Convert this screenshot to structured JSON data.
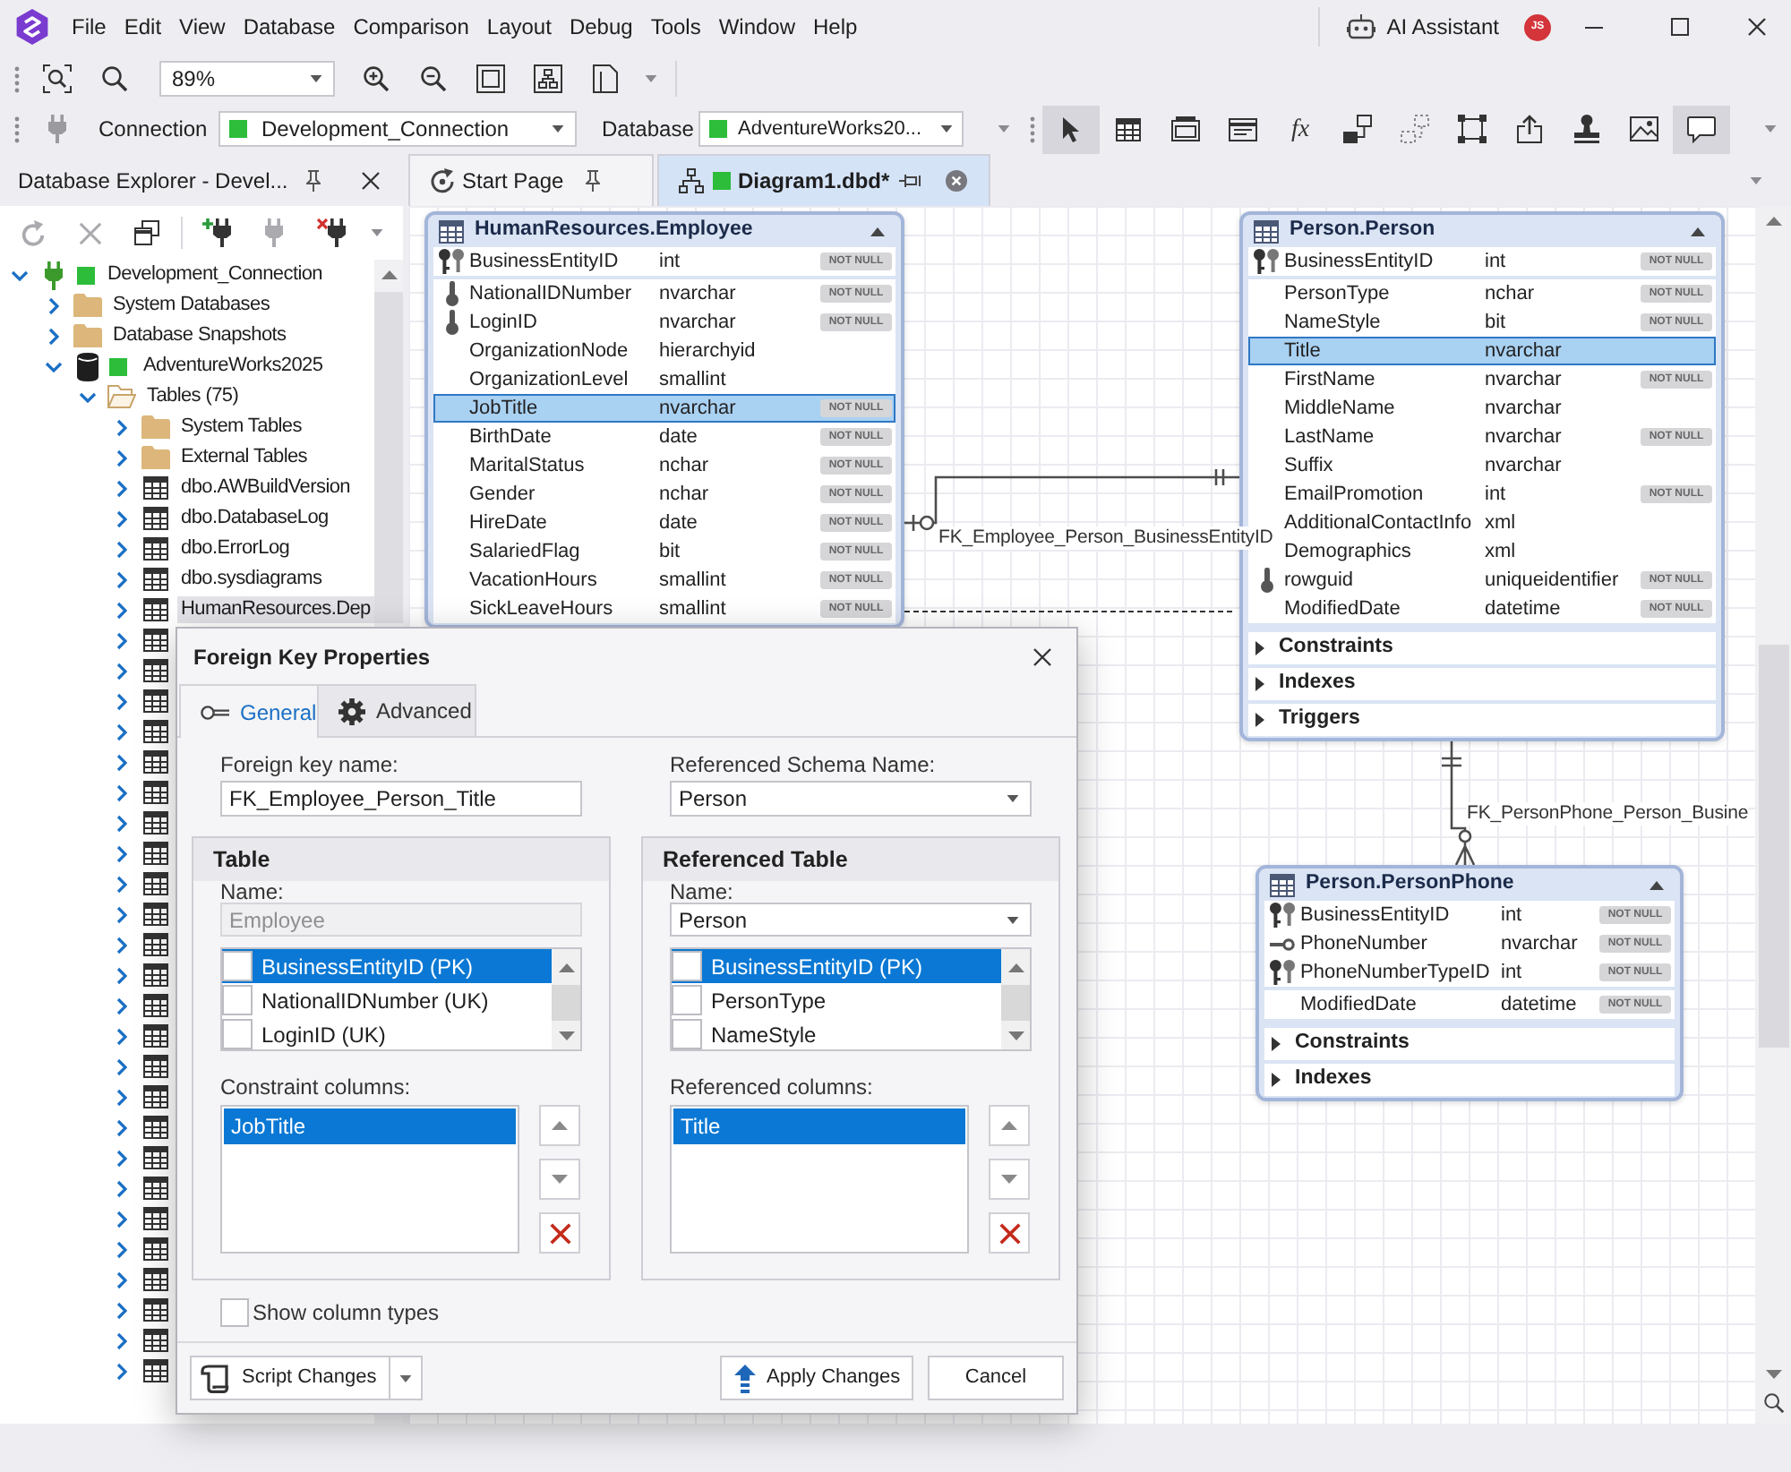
{
  "title_bar": {
    "menu": [
      "File",
      "Edit",
      "View",
      "Database",
      "Comparison",
      "Layout",
      "Debug",
      "Tools",
      "Window",
      "Help"
    ],
    "assistant": "AI Assistant",
    "avatar": "JS"
  },
  "toolbar": {
    "zoom": "89%"
  },
  "connection_bar": {
    "connection_label": "Connection",
    "connection": "Development_Connection",
    "database_label": "Database",
    "database": "AdventureWorks20...",
    "tools": [
      {
        "kind": "pointer",
        "selected": true
      },
      {
        "kind": "table",
        "selected": false
      },
      {
        "kind": "view",
        "selected": false
      },
      {
        "kind": "procedure",
        "selected": false
      },
      {
        "kind": "function",
        "glyph": "fx",
        "selected": false
      },
      {
        "kind": "relation",
        "selected": false
      },
      {
        "kind": "virtual_relation",
        "selected": false
      },
      {
        "kind": "container",
        "selected": false
      },
      {
        "kind": "export",
        "selected": false
      },
      {
        "kind": "stamp",
        "selected": false
      },
      {
        "kind": "image",
        "selected": false
      },
      {
        "kind": "note",
        "selected": true
      }
    ]
  },
  "explorer": {
    "title": "Database Explorer - Devel...",
    "tools": [
      {
        "kind": "refresh",
        "disabled": true
      },
      {
        "kind": "delete",
        "disabled": true
      },
      {
        "kind": "windows",
        "disabled": false
      },
      {
        "kind": "new_connection",
        "disabled": false
      },
      {
        "kind": "disconnect",
        "disabled": true
      },
      {
        "kind": "remove_connection",
        "disabled": false
      }
    ],
    "tree": [
      {
        "label": "Development_Connection",
        "kind": "connection",
        "expanded": true,
        "selected": false,
        "children": [
          {
            "label": "System Databases",
            "kind": "folder",
            "expanded": false,
            "selected": false
          },
          {
            "label": "Database Snapshots",
            "kind": "folder",
            "expanded": false,
            "selected": false
          },
          {
            "label": "AdventureWorks2025",
            "kind": "database",
            "expanded": true,
            "selected": false,
            "children": [
              {
                "label": "Tables (75)",
                "kind": "folder",
                "expanded": true,
                "selected": false,
                "children": [
                  {
                    "label": "System Tables",
                    "kind": "folder",
                    "expanded": false,
                    "selected": false
                  },
                  {
                    "label": "External Tables",
                    "kind": "folder",
                    "expanded": false,
                    "selected": false
                  },
                  {
                    "label": "dbo.AWBuildVersion",
                    "kind": "table",
                    "expanded": false,
                    "selected": false
                  },
                  {
                    "label": "dbo.DatabaseLog",
                    "kind": "table",
                    "expanded": false,
                    "selected": false
                  },
                  {
                    "label": "dbo.ErrorLog",
                    "kind": "table",
                    "expanded": false,
                    "selected": false
                  },
                  {
                    "label": "dbo.sysdiagrams",
                    "kind": "table",
                    "expanded": false,
                    "selected": false
                  },
                  {
                    "label": "HumanResources.Dep",
                    "kind": "table",
                    "expanded": false,
                    "selected": true
                  },
                  {
                    "kind": "table",
                    "expanded": false,
                    "selected": false
                  },
                  {
                    "kind": "table",
                    "expanded": false,
                    "selected": false
                  },
                  {
                    "kind": "table",
                    "expanded": false,
                    "selected": false
                  },
                  {
                    "kind": "table",
                    "expanded": false,
                    "selected": false
                  },
                  {
                    "kind": "table",
                    "expanded": false,
                    "selected": false
                  },
                  {
                    "kind": "table",
                    "expanded": false,
                    "selected": false
                  },
                  {
                    "kind": "table",
                    "expanded": false,
                    "selected": false
                  },
                  {
                    "kind": "table",
                    "expanded": false,
                    "selected": false
                  },
                  {
                    "kind": "table",
                    "expanded": false,
                    "selected": false
                  },
                  {
                    "kind": "table",
                    "expanded": false,
                    "selected": false
                  },
                  {
                    "kind": "table",
                    "expanded": false,
                    "selected": false
                  },
                  {
                    "kind": "table",
                    "expanded": false,
                    "selected": false
                  },
                  {
                    "kind": "table",
                    "expanded": false,
                    "selected": false
                  },
                  {
                    "kind": "table",
                    "expanded": false,
                    "selected": false
                  },
                  {
                    "kind": "table",
                    "expanded": false,
                    "selected": false
                  },
                  {
                    "kind": "table",
                    "expanded": false,
                    "selected": false
                  },
                  {
                    "kind": "table",
                    "expanded": false,
                    "selected": false
                  },
                  {
                    "kind": "table",
                    "expanded": false,
                    "selected": false
                  },
                  {
                    "kind": "table",
                    "expanded": false,
                    "selected": false
                  },
                  {
                    "kind": "table",
                    "expanded": false,
                    "selected": false
                  },
                  {
                    "kind": "table",
                    "expanded": false,
                    "selected": false
                  },
                  {
                    "kind": "table",
                    "expanded": false,
                    "selected": false
                  },
                  {
                    "kind": "table",
                    "expanded": false,
                    "selected": false
                  },
                  {
                    "kind": "table",
                    "expanded": false,
                    "selected": false
                  },
                  {
                    "kind": "table",
                    "expanded": false,
                    "selected": false
                  }
                ]
              }
            ]
          }
        ]
      }
    ]
  },
  "document_tabs": [
    {
      "label": "Start Page",
      "kind": "start",
      "selected": false
    },
    {
      "label": "Diagram1.dbd*",
      "kind": "diagram",
      "selected": true
    }
  ],
  "diagram": {
    "tables": [
      {
        "name": "HumanResources.Employee",
        "key_columns": [
          {
            "name": "BusinessEntityID",
            "type": "int",
            "kind": "foreign",
            "flag": "NOT NULL",
            "selected": false
          }
        ],
        "columns": [
          {
            "name": "NationalIDNumber",
            "type": "nvarchar",
            "kind": "unique",
            "flag": "NOT NULL",
            "selected": false
          },
          {
            "name": "LoginID",
            "type": "nvarchar",
            "kind": "unique",
            "flag": "NOT NULL",
            "selected": false
          },
          {
            "name": "OrganizationNode",
            "type": "hierarchyid",
            "kind": "plain",
            "selected": false
          },
          {
            "name": "OrganizationLevel",
            "type": "smallint",
            "kind": "plain",
            "selected": false
          },
          {
            "name": "JobTitle",
            "type": "nvarchar",
            "kind": "plain",
            "flag": "NOT NULL",
            "selected": true
          },
          {
            "name": "BirthDate",
            "type": "date",
            "kind": "plain",
            "flag": "NOT NULL",
            "selected": false
          },
          {
            "name": "MaritalStatus",
            "type": "nchar",
            "kind": "plain",
            "flag": "NOT NULL",
            "selected": false
          },
          {
            "name": "Gender",
            "type": "nchar",
            "kind": "plain",
            "flag": "NOT NULL",
            "selected": false
          },
          {
            "name": "HireDate",
            "type": "date",
            "kind": "plain",
            "flag": "NOT NULL",
            "selected": false
          },
          {
            "name": "SalariedFlag",
            "type": "bit",
            "kind": "plain",
            "flag": "NOT NULL",
            "selected": false
          },
          {
            "name": "VacationHours",
            "type": "smallint",
            "kind": "plain",
            "flag": "NOT NULL",
            "selected": false
          },
          {
            "name": "SickLeaveHours",
            "type": "smallint",
            "kind": "plain",
            "flag": "NOT NULL",
            "selected": false
          }
        ]
      },
      {
        "name": "Person.Person",
        "key_columns": [
          {
            "name": "BusinessEntityID",
            "type": "int",
            "kind": "foreign",
            "flag": "NOT NULL",
            "selected": false
          }
        ],
        "columns": [
          {
            "name": "PersonType",
            "type": "nchar",
            "kind": "plain",
            "flag": "NOT NULL",
            "selected": false
          },
          {
            "name": "NameStyle",
            "type": "bit",
            "kind": "plain",
            "flag": "NOT NULL",
            "selected": false
          },
          {
            "name": "Title",
            "type": "nvarchar",
            "kind": "plain",
            "selected": true
          },
          {
            "name": "FirstName",
            "type": "nvarchar",
            "kind": "plain",
            "flag": "NOT NULL",
            "selected": false
          },
          {
            "name": "MiddleName",
            "type": "nvarchar",
            "kind": "plain",
            "selected": false
          },
          {
            "name": "LastName",
            "type": "nvarchar",
            "kind": "plain",
            "flag": "NOT NULL",
            "selected": false
          },
          {
            "name": "Suffix",
            "type": "nvarchar",
            "kind": "plain",
            "selected": false
          },
          {
            "name": "EmailPromotion",
            "type": "int",
            "kind": "plain",
            "flag": "NOT NULL",
            "selected": false
          },
          {
            "name": "AdditionalContactInfo",
            "type": "xml",
            "kind": "plain",
            "selected": false
          },
          {
            "name": "Demographics",
            "type": "xml",
            "kind": "plain",
            "selected": false
          },
          {
            "name": "rowguid",
            "type": "uniqueidentifier",
            "kind": "unique",
            "flag": "NOT NULL",
            "selected": false
          },
          {
            "name": "ModifiedDate",
            "type": "datetime",
            "kind": "plain",
            "flag": "NOT NULL",
            "selected": false
          }
        ],
        "sections": [
          {
            "label": "Constraints",
            "expanded": false
          },
          {
            "label": "Indexes",
            "expanded": false
          },
          {
            "label": "Triggers",
            "expanded": false
          }
        ]
      },
      {
        "name": "Person.PersonPhone",
        "key_columns": [
          {
            "name": "BusinessEntityID",
            "type": "int",
            "kind": "foreign",
            "flag": "NOT NULL",
            "selected": false
          },
          {
            "name": "PhoneNumber",
            "type": "nvarchar",
            "kind": "primary",
            "flag": "NOT NULL",
            "selected": false
          },
          {
            "name": "PhoneNumberTypeID",
            "type": "int",
            "kind": "foreign",
            "flag": "NOT NULL",
            "selected": false
          }
        ],
        "columns": [
          {
            "name": "ModifiedDate",
            "type": "datetime",
            "kind": "plain",
            "flag": "NOT NULL",
            "selected": false
          }
        ],
        "sections": [
          {
            "label": "Constraints",
            "expanded": false
          },
          {
            "label": "Indexes",
            "expanded": false
          }
        ]
      }
    ],
    "relations": [
      {
        "name": "FK_Employee_Person_BusinessEntityID"
      },
      {
        "name": "FK_PersonPhone_Person_Busine"
      }
    ]
  },
  "dialog": {
    "title": "Foreign Key Properties",
    "tabs": [
      {
        "label": "General",
        "kind": "general",
        "selected": true
      },
      {
        "label": "Advanced",
        "kind": "advanced",
        "selected": false
      }
    ],
    "fields": [
      {
        "label": "Foreign key name:",
        "value": "FK_Employee_Person_Title",
        "kind": "text"
      },
      {
        "label": "Referenced Schema Name:",
        "value": "Person",
        "kind": "combo"
      }
    ],
    "groups": [
      {
        "title": "Table",
        "name_label": "Name:",
        "name": {
          "value": "Employee",
          "disabled": true
        },
        "columns": [
          {
            "label": "BusinessEntityID (PK)",
            "checked": false,
            "selected": true
          },
          {
            "label": "NationalIDNumber (UK)",
            "checked": false,
            "selected": false
          },
          {
            "label": "LoginID (UK)",
            "checked": false,
            "selected": false
          }
        ],
        "list_label": "Constraint columns:",
        "list": [
          {
            "label": "JobTitle",
            "selected": true
          }
        ]
      },
      {
        "title": "Referenced Table",
        "name_label": "Name:",
        "name": {
          "value": "Person",
          "disabled": false
        },
        "columns": [
          {
            "label": "BusinessEntityID (PK)",
            "checked": false,
            "selected": true
          },
          {
            "label": "PersonType",
            "checked": false,
            "selected": false
          },
          {
            "label": "NameStyle",
            "checked": false,
            "selected": false
          }
        ],
        "list_label": "Referenced columns:",
        "list": [
          {
            "label": "Title",
            "selected": true
          }
        ]
      }
    ],
    "show_types": {
      "label": "Show column types",
      "checked": false
    },
    "buttons": [
      {
        "label": "Script Changes",
        "kind": "script"
      },
      {
        "label": "Apply Changes",
        "kind": "apply"
      },
      {
        "label": "Cancel",
        "kind": "cancel"
      }
    ]
  }
}
